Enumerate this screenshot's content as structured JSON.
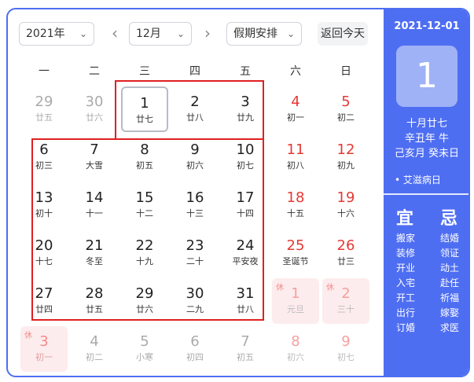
{
  "toolbar": {
    "year": "2021年",
    "month": "12月",
    "holiday": "假期安排",
    "prev_icon": "chevron-left-icon",
    "next_icon": "chevron-right-icon",
    "today": "返回今天"
  },
  "weekdays": [
    "一",
    "二",
    "三",
    "四",
    "五",
    "六",
    "日"
  ],
  "rows": [
    [
      {
        "day": "29",
        "lunar": "廿五",
        "other": true
      },
      {
        "day": "30",
        "lunar": "廿六",
        "other": true
      },
      {
        "day": "1",
        "lunar": "廿七",
        "today": true
      },
      {
        "day": "2",
        "lunar": "廿八"
      },
      {
        "day": "3",
        "lunar": "廿九"
      },
      {
        "day": "4",
        "lunar": "初一",
        "weekend": true
      },
      {
        "day": "5",
        "lunar": "初二",
        "weekend": true
      }
    ],
    [
      {
        "day": "6",
        "lunar": "初三"
      },
      {
        "day": "7",
        "lunar": "大雪"
      },
      {
        "day": "8",
        "lunar": "初五"
      },
      {
        "day": "9",
        "lunar": "初六"
      },
      {
        "day": "10",
        "lunar": "初七"
      },
      {
        "day": "11",
        "lunar": "初八",
        "weekend": true
      },
      {
        "day": "12",
        "lunar": "初九",
        "weekend": true
      }
    ],
    [
      {
        "day": "13",
        "lunar": "初十"
      },
      {
        "day": "14",
        "lunar": "十一"
      },
      {
        "day": "15",
        "lunar": "十二"
      },
      {
        "day": "16",
        "lunar": "十三"
      },
      {
        "day": "17",
        "lunar": "十四"
      },
      {
        "day": "18",
        "lunar": "十五",
        "weekend": true
      },
      {
        "day": "19",
        "lunar": "十六",
        "weekend": true
      }
    ],
    [
      {
        "day": "20",
        "lunar": "十七"
      },
      {
        "day": "21",
        "lunar": "冬至"
      },
      {
        "day": "22",
        "lunar": "十九"
      },
      {
        "day": "23",
        "lunar": "二十"
      },
      {
        "day": "24",
        "lunar": "平安夜"
      },
      {
        "day": "25",
        "lunar": "圣诞节",
        "weekend": true
      },
      {
        "day": "26",
        "lunar": "廿三",
        "weekend": true
      }
    ],
    [
      {
        "day": "27",
        "lunar": "廿四"
      },
      {
        "day": "28",
        "lunar": "廿五"
      },
      {
        "day": "29",
        "lunar": "廿六"
      },
      {
        "day": "30",
        "lunar": "二九"
      },
      {
        "day": "31",
        "lunar": "廿八"
      },
      {
        "day": "1",
        "lunar": "元旦",
        "other": true,
        "holiday": true,
        "tag": "休"
      },
      {
        "day": "2",
        "lunar": "三十",
        "other": true,
        "holiday": true,
        "tag": "休"
      }
    ],
    [
      {
        "day": "3",
        "lunar": "初一",
        "other": true,
        "holiday": true,
        "tag": "休"
      },
      {
        "day": "4",
        "lunar": "初二",
        "other": true
      },
      {
        "day": "5",
        "lunar": "小寒",
        "other": true
      },
      {
        "day": "6",
        "lunar": "初四",
        "other": true
      },
      {
        "day": "7",
        "lunar": "初五",
        "other": true
      },
      {
        "day": "8",
        "lunar": "初六",
        "other": true,
        "weekend": true
      },
      {
        "day": "9",
        "lunar": "初七",
        "other": true,
        "weekend": true
      }
    ]
  ],
  "side": {
    "date": "2021-12-01",
    "day": "1",
    "lunar": "十月廿七",
    "ganzhi_year": "辛丑年 牛",
    "ganzhi_day": "己亥月 癸未日",
    "festival": "• 艾滋病日",
    "yi_label": "宜",
    "ji_label": "忌",
    "yi": [
      "搬家",
      "装修",
      "开业",
      "入宅",
      "开工",
      "出行",
      "订婚"
    ],
    "ji": [
      "结婚",
      "领证",
      "动土",
      "赴任",
      "祈福",
      "嫁娶",
      "求医"
    ]
  },
  "colors": {
    "accent": "#4e6ef2",
    "weekend_red": "#e53935",
    "highlight_box": "#e02020",
    "holiday_bg": "#fdeced"
  }
}
